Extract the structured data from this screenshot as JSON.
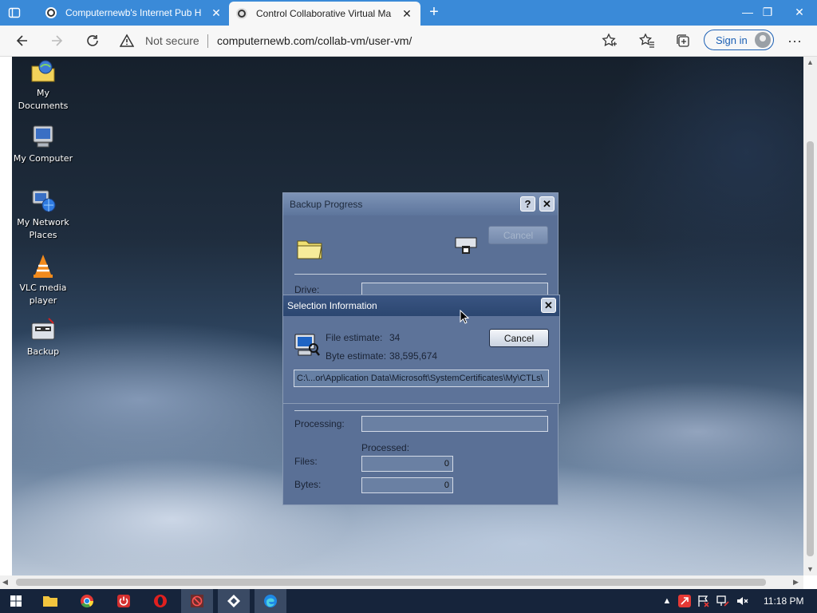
{
  "browser": {
    "tabs": [
      {
        "title": "Computernewb's Internet Pub H",
        "active": false
      },
      {
        "title": "Control Collaborative Virtual Ma",
        "active": true
      }
    ],
    "security_label": "Not secure",
    "url": "computernewb.com/collab-vm/user-vm/",
    "sign_in_label": "Sign in",
    "accent_color": "#3a8ad8"
  },
  "desktop": {
    "icons": [
      {
        "label_line1": "My",
        "label_line2": "Documents",
        "icon": "my-documents-icon"
      },
      {
        "label_line1": "My Computer",
        "label_line2": "",
        "icon": "my-computer-icon"
      },
      {
        "label_line1": "My Network",
        "label_line2": "Places",
        "icon": "network-places-icon"
      },
      {
        "label_line1": "VLC media",
        "label_line2": "player",
        "icon": "vlc-icon"
      },
      {
        "label_line1": "Backup",
        "label_line2": "",
        "icon": "backup-icon"
      }
    ]
  },
  "backup_progress": {
    "title": "Backup Progress",
    "cancel_label": "Cancel",
    "drive_label": "Drive:",
    "processing_label": "Processing:",
    "processed_label": "Processed:",
    "files_label": "Files:",
    "bytes_label": "Bytes:",
    "files_value": "0",
    "bytes_value": "0"
  },
  "selection_info": {
    "title": "Selection Information",
    "file_estimate_label": "File estimate:",
    "file_estimate_value": "34",
    "byte_estimate_label": "Byte estimate:",
    "byte_estimate_value": "38,595,674",
    "cancel_label": "Cancel",
    "current_path": "C:\\...or\\Application Data\\Microsoft\\SystemCertificates\\My\\CTLs\\"
  },
  "taskbar": {
    "clock": "11:18 PM"
  }
}
